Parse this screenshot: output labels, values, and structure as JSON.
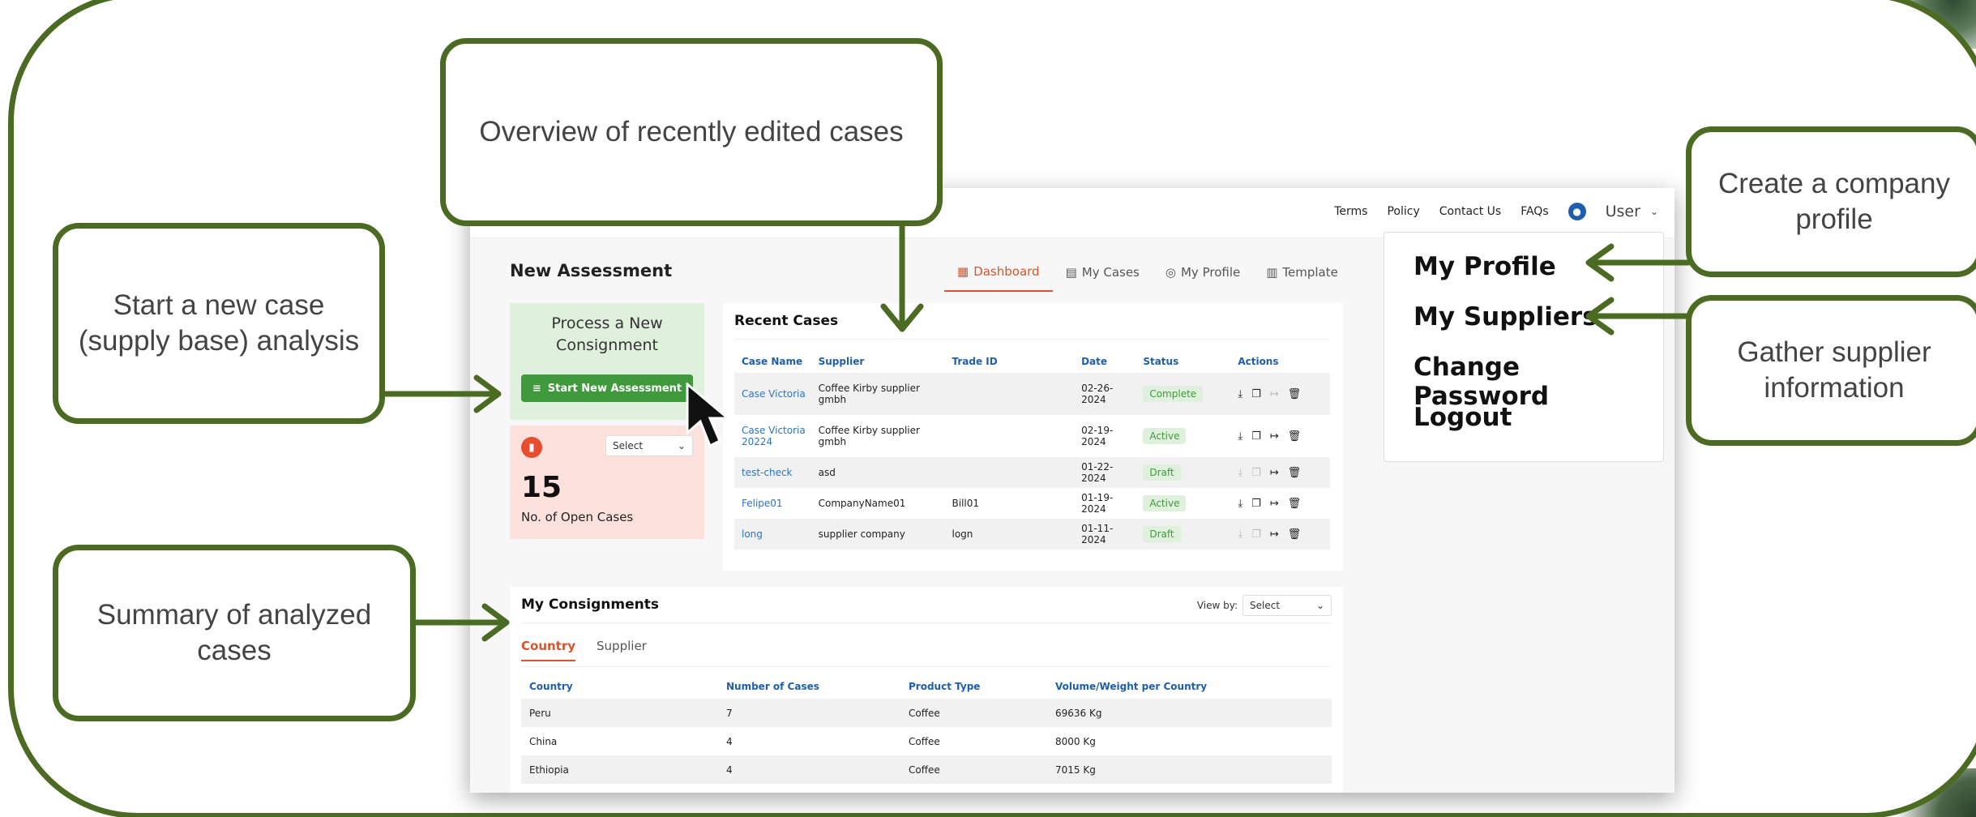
{
  "callouts": {
    "overview": "Overview of recently edited cases",
    "new_case": "Start a new case (supply base) analysis",
    "summary": "Summary of analyzed cases",
    "company_profile": "Create a company profile",
    "gather_supplier": "Gather supplier information"
  },
  "topnav": {
    "terms": "Terms",
    "policy": "Policy",
    "contact": "Contact Us",
    "faqs": "FAQs",
    "user": "User"
  },
  "page_title": "New Assessment",
  "tabs": [
    {
      "label": "Dashboard",
      "icon": "grid-icon"
    },
    {
      "label": "My Cases",
      "icon": "document-icon"
    },
    {
      "label": "My Profile",
      "icon": "user-circle-icon"
    },
    {
      "label": "Template",
      "icon": "table-icon"
    }
  ],
  "new_card": {
    "title": "Process a New Consignment",
    "button": "Start New Assessment"
  },
  "open_card": {
    "select": "Select",
    "count": "15",
    "label": "No. of Open Cases"
  },
  "recent": {
    "title": "Recent Cases",
    "columns": [
      "Case Name",
      "Supplier",
      "Trade ID",
      "Date",
      "Status",
      "Actions"
    ],
    "rows": [
      {
        "name": "Case Victoria",
        "supplier": "Coffee Kirby supplier gmbh",
        "trade": "",
        "date": "02-26-2024",
        "status": "Complete"
      },
      {
        "name": "Case Victoria 20224",
        "supplier": "Coffee Kirby supplier gmbh",
        "trade": "",
        "date": "02-19-2024",
        "status": "Active"
      },
      {
        "name": "test-check",
        "supplier": "asd",
        "trade": "",
        "date": "01-22-2024",
        "status": "Draft"
      },
      {
        "name": "Felipe01",
        "supplier": "CompanyName01",
        "trade": "Bill01",
        "date": "01-19-2024",
        "status": "Active"
      },
      {
        "name": "long",
        "supplier": "supplier company",
        "trade": "logn",
        "date": "01-11-2024",
        "status": "Draft"
      }
    ]
  },
  "dropdown": [
    "My Profile",
    "My Suppliers",
    "Change Password",
    "Logout"
  ],
  "consignments": {
    "title": "My Consignments",
    "view_by": "View by:",
    "select": "Select",
    "tabs": [
      "Country",
      "Supplier"
    ],
    "columns": [
      "Country",
      "Number of Cases",
      "Product Type",
      "Volume/Weight per Country"
    ],
    "rows": [
      {
        "country": "Peru",
        "cases": "7",
        "product": "Coffee",
        "volume": "69636 Kg"
      },
      {
        "country": "China",
        "cases": "4",
        "product": "Coffee",
        "volume": "8000 Kg"
      },
      {
        "country": "Ethiopia",
        "cases": "4",
        "product": "Coffee",
        "volume": "7015 Kg"
      }
    ]
  },
  "colors": {
    "frame": "#4b6b22",
    "accent": "#d9532b",
    "link": "#2b73c6",
    "green_button": "#3f9a3c"
  }
}
